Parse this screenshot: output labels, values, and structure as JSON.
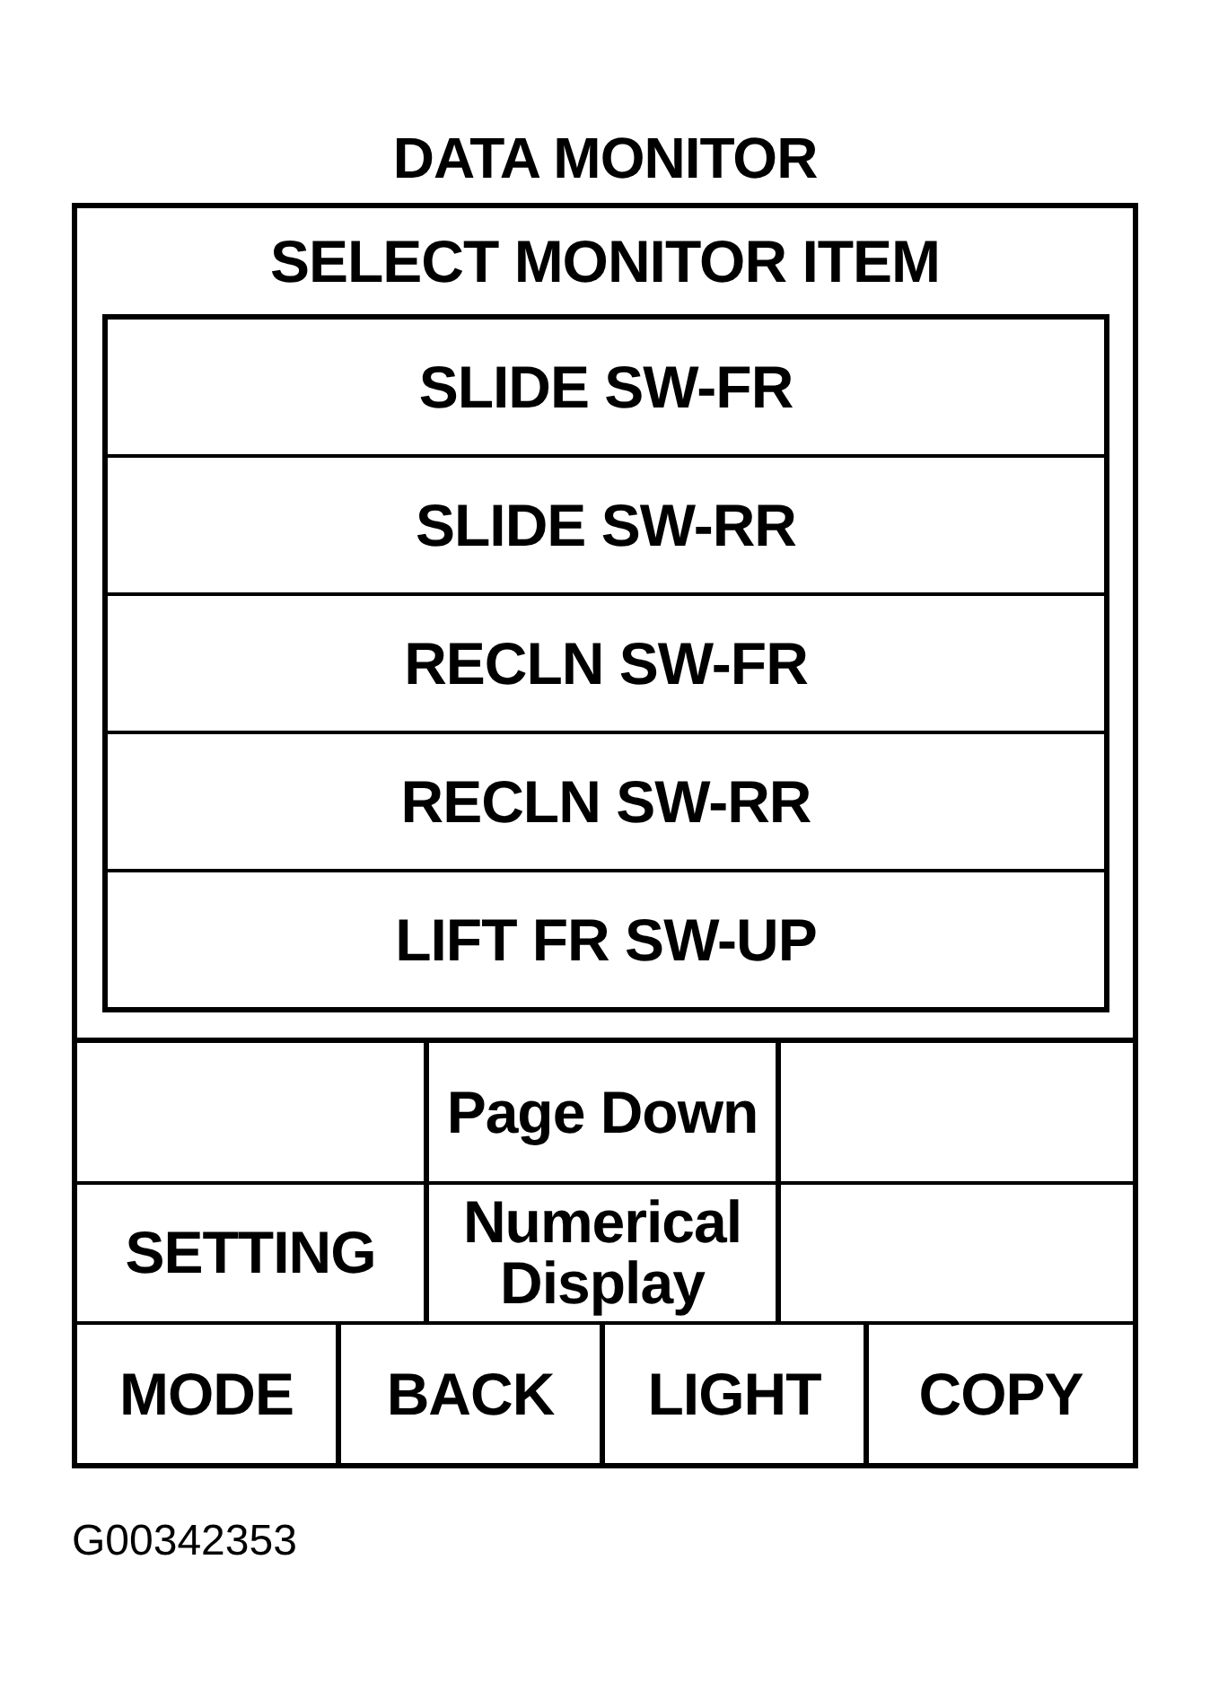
{
  "title": "DATA MONITOR",
  "panel": {
    "heading": "SELECT MONITOR ITEM",
    "items": [
      "SLIDE SW-FR",
      "SLIDE SW-RR",
      "RECLN SW-FR",
      "RECLN SW-RR",
      "LIFT FR SW-UP"
    ]
  },
  "key_rows": [
    {
      "keys": [
        {
          "kind": "blank"
        },
        {
          "kind": "key",
          "label": "Page Down"
        },
        {
          "kind": "blank"
        }
      ]
    },
    {
      "keys": [
        {
          "kind": "key",
          "label": "SETTING"
        },
        {
          "kind": "key",
          "label": "Numerical Display"
        },
        {
          "kind": "blank"
        }
      ]
    },
    {
      "keys": [
        {
          "kind": "key",
          "label": "MODE"
        },
        {
          "kind": "key",
          "label": "BACK"
        },
        {
          "kind": "key",
          "label": "LIGHT"
        },
        {
          "kind": "key",
          "label": "COPY"
        }
      ]
    }
  ],
  "figure_code": "G00342353"
}
